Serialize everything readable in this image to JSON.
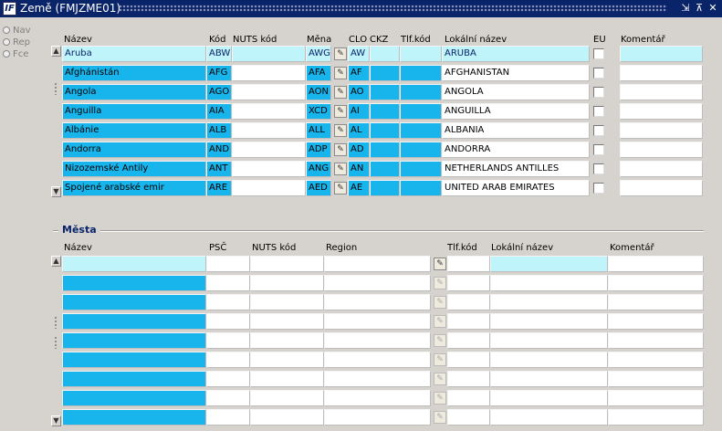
{
  "window": {
    "title": "Země (FMJZME01)",
    "logo": "IF",
    "min": "⇲",
    "max": "⊼",
    "close": "✕"
  },
  "nav_radios": [
    "Nav",
    "Rep",
    "Fce"
  ],
  "countries": {
    "headers": {
      "name": "Název",
      "code": "Kód",
      "nuts": "NUTS kód",
      "currency": "Měna",
      "clo": "CLO",
      "ckz": "CKZ",
      "tlf": "Tlf.kód",
      "local": "Lokální název",
      "eu": "EU",
      "comment": "Komentář"
    },
    "rows": [
      {
        "name": "Aruba",
        "code": "ABW",
        "nuts": "",
        "currency": "AWG",
        "clo": "AW",
        "ckz": "",
        "tlf": "",
        "local": "ARUBA",
        "eu": false,
        "comment": ""
      },
      {
        "name": "Afghánistán",
        "code": "AFG",
        "nuts": "",
        "currency": "AFA",
        "clo": "AF",
        "ckz": "",
        "tlf": "",
        "local": "AFGHANISTAN",
        "eu": false,
        "comment": ""
      },
      {
        "name": "Angola",
        "code": "AGO",
        "nuts": "",
        "currency": "AON",
        "clo": "AO",
        "ckz": "",
        "tlf": "",
        "local": "ANGOLA",
        "eu": false,
        "comment": ""
      },
      {
        "name": "Anguilla",
        "code": "AIA",
        "nuts": "",
        "currency": "XCD",
        "clo": "AI",
        "ckz": "",
        "tlf": "",
        "local": "ANGUILLA",
        "eu": false,
        "comment": ""
      },
      {
        "name": "Albánie",
        "code": "ALB",
        "nuts": "",
        "currency": "ALL",
        "clo": "AL",
        "ckz": "",
        "tlf": "",
        "local": "ALBANIA",
        "eu": false,
        "comment": ""
      },
      {
        "name": "Andorra",
        "code": "AND",
        "nuts": "",
        "currency": "ADP",
        "clo": "AD",
        "ckz": "",
        "tlf": "",
        "local": "ANDORRA",
        "eu": false,
        "comment": ""
      },
      {
        "name": "Nizozemské Antily",
        "code": "ANT",
        "nuts": "",
        "currency": "ANG",
        "clo": "AN",
        "ckz": "",
        "tlf": "",
        "local": "NETHERLANDS ANTILLES",
        "eu": false,
        "comment": ""
      },
      {
        "name": "Spojené arabské emir",
        "code": "ARE",
        "nuts": "",
        "currency": "AED",
        "clo": "AE",
        "ckz": "",
        "tlf": "",
        "local": "UNITED ARAB EMIRATES",
        "eu": false,
        "comment": ""
      }
    ]
  },
  "cities": {
    "section_label": "Města",
    "headers": {
      "name": "Název",
      "psc": "PSČ",
      "nuts": "NUTS kód",
      "region": "Region",
      "tlf": "Tlf.kód",
      "local": "Lokální název",
      "comment": "Komentář"
    },
    "row_count": 9
  },
  "colors": {
    "query_field": "#18b5ec",
    "current_record": "#bff4fb",
    "titlebar": "#0a246a"
  },
  "icons": {
    "lov": "lov-edit-icon",
    "scroll_up": "scroll-up-icon",
    "scroll_down": "scroll-down-icon"
  }
}
